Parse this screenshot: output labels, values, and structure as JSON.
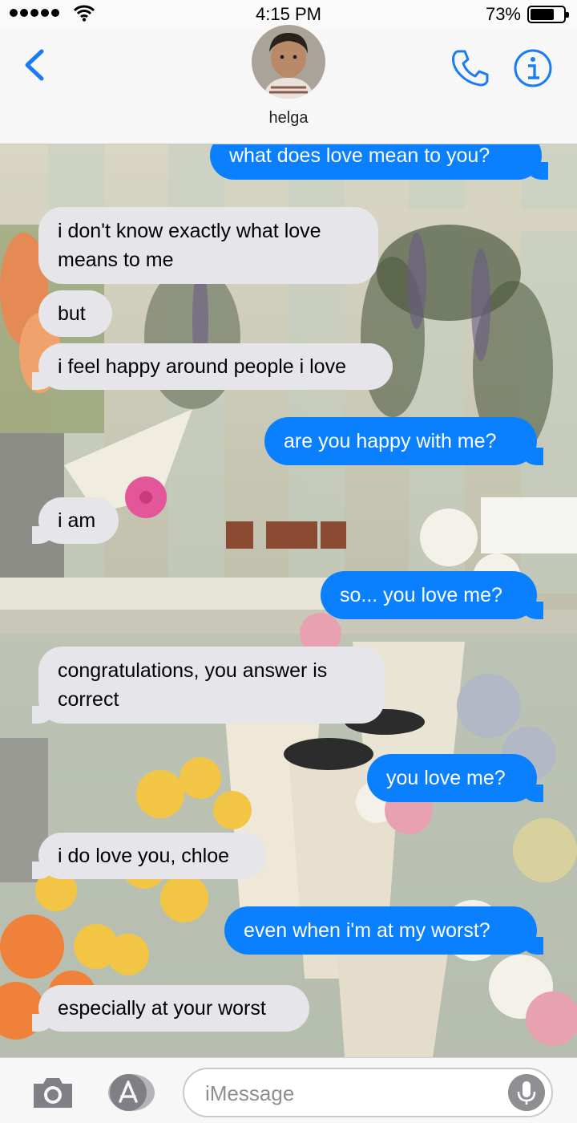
{
  "status_bar": {
    "time": "4:15 PM",
    "battery_percent": "73%",
    "battery_level": 0.73,
    "icons": [
      "signal-icon",
      "wifi-icon",
      "battery-icon"
    ]
  },
  "header": {
    "contact_name": "helga",
    "icons": [
      "back-chevron-icon",
      "phone-icon",
      "info-icon"
    ],
    "accent_color": "#1a7cf5"
  },
  "messages": [
    {
      "direction": "outgoing",
      "text": "what does love mean to you?"
    },
    {
      "direction": "incoming",
      "text": "i don't know exactly what love means to me"
    },
    {
      "direction": "incoming",
      "text": "but"
    },
    {
      "direction": "incoming",
      "text": "i feel happy around people i love"
    },
    {
      "direction": "outgoing",
      "text": "are you happy with me?"
    },
    {
      "direction": "incoming",
      "text": "i am"
    },
    {
      "direction": "outgoing",
      "text": "so... you love me?"
    },
    {
      "direction": "incoming",
      "text": "congratulations, you answer is correct"
    },
    {
      "direction": "outgoing",
      "text": "you love me?"
    },
    {
      "direction": "incoming",
      "text": "i do love you, chloe"
    },
    {
      "direction": "outgoing",
      "text": "even when i'm at my worst?"
    },
    {
      "direction": "incoming",
      "text": "especially at your worst"
    }
  ],
  "bubble_colors": {
    "incoming": "#e5e5ea",
    "outgoing": "#0b80ff"
  },
  "input_bar": {
    "placeholder": "iMessage",
    "icons": [
      "camera-icon",
      "app-store-icon",
      "microphone-icon"
    ]
  }
}
